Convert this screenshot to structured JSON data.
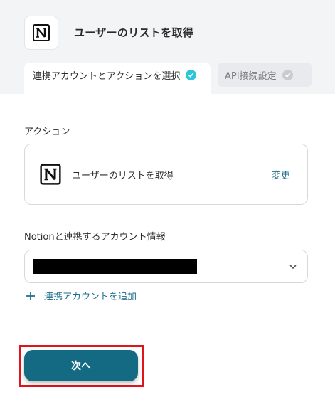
{
  "header": {
    "title": "ユーザーのリストを取得",
    "app_icon": "notion-logo-icon"
  },
  "tabs": [
    {
      "label": "連携アカウントとアクションを選択",
      "state": "active",
      "icon": "check-circle-icon",
      "icon_color": "#2cc7d6"
    },
    {
      "label": "API接続設定",
      "state": "inactive",
      "icon": "check-circle-icon",
      "icon_color": "#c9cbcf"
    }
  ],
  "action_section": {
    "label": "アクション",
    "card": {
      "icon": "notion-logo-icon",
      "text": "ユーザーのリストを取得",
      "change_label": "変更"
    }
  },
  "account_section": {
    "label": "Notionと連携するアカウント情報",
    "select": {
      "value_redacted": true,
      "dropdown_icon": "chevron-down-icon"
    },
    "add_account_label": "連携アカウントを追加",
    "add_icon": "plus-icon"
  },
  "footer": {
    "next_label": "次へ"
  },
  "colors": {
    "accent": "#146a82",
    "link": "#1f6f8b",
    "check_active": "#2cc7d6",
    "highlight": "#e0141b"
  }
}
